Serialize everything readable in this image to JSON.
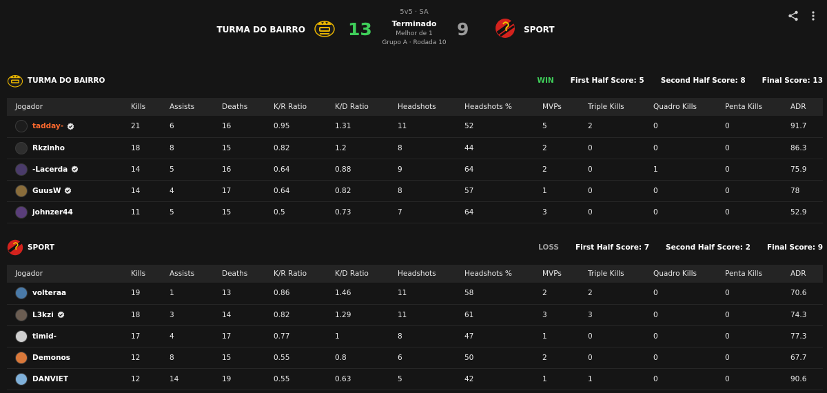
{
  "match": {
    "format": "5v5 · SA",
    "status": "Terminado",
    "best_of": "Melhor de 1",
    "group_round": "Grupo A · Rodada 10",
    "team_a": {
      "name": "TURMA DO BAIRRO",
      "score": "13"
    },
    "team_b": {
      "name": "SPORT",
      "score": "9"
    }
  },
  "colors": {
    "win": "#3fcf5a",
    "loss": "#9b9b9b",
    "highlight": "#ff6a2e",
    "background": "#151515",
    "header_row": "#242424"
  },
  "columns": [
    "Jogador",
    "Kills",
    "Assists",
    "Deaths",
    "K/R Ratio",
    "K/D Ratio",
    "Headshots",
    "Headshots %",
    "MVPs",
    "Triple Kills",
    "Quadro Kills",
    "Penta Kills",
    "ADR"
  ],
  "teams": [
    {
      "name": "TURMA DO BAIRRO",
      "result": "WIN",
      "first_half": "First Half Score: 5",
      "second_half": "Second Half Score: 8",
      "final": "Final Score: 13",
      "players": [
        {
          "name": "tadday-",
          "verified": true,
          "highlight": true,
          "stats": [
            "21",
            "6",
            "16",
            "0.95",
            "1.31",
            "11",
            "52",
            "5",
            "2",
            "0",
            "0",
            "91.7"
          ]
        },
        {
          "name": "Rkzinho",
          "verified": false,
          "highlight": false,
          "stats": [
            "18",
            "8",
            "15",
            "0.82",
            "1.2",
            "8",
            "44",
            "2",
            "0",
            "0",
            "0",
            "86.3"
          ]
        },
        {
          "name": "-Lacerda",
          "verified": true,
          "highlight": false,
          "stats": [
            "14",
            "5",
            "16",
            "0.64",
            "0.88",
            "9",
            "64",
            "2",
            "0",
            "1",
            "0",
            "75.9"
          ]
        },
        {
          "name": "GuusW",
          "verified": true,
          "highlight": false,
          "stats": [
            "14",
            "4",
            "17",
            "0.64",
            "0.82",
            "8",
            "57",
            "1",
            "0",
            "0",
            "0",
            "78"
          ]
        },
        {
          "name": "johnzer44",
          "verified": false,
          "highlight": false,
          "stats": [
            "11",
            "5",
            "15",
            "0.5",
            "0.73",
            "7",
            "64",
            "3",
            "0",
            "0",
            "0",
            "52.9"
          ]
        }
      ]
    },
    {
      "name": "SPORT",
      "result": "LOSS",
      "first_half": "First Half Score: 7",
      "second_half": "Second Half Score: 2",
      "final": "Final Score: 9",
      "players": [
        {
          "name": "volteraa",
          "verified": false,
          "highlight": false,
          "stats": [
            "19",
            "1",
            "13",
            "0.86",
            "1.46",
            "11",
            "58",
            "2",
            "2",
            "0",
            "0",
            "70.6"
          ]
        },
        {
          "name": "L3kzi",
          "verified": true,
          "highlight": false,
          "stats": [
            "18",
            "3",
            "14",
            "0.82",
            "1.29",
            "11",
            "61",
            "3",
            "3",
            "0",
            "0",
            "74.3"
          ]
        },
        {
          "name": "timid-",
          "verified": false,
          "highlight": false,
          "stats": [
            "17",
            "4",
            "17",
            "0.77",
            "1",
            "8",
            "47",
            "1",
            "0",
            "0",
            "0",
            "77.3"
          ]
        },
        {
          "name": "Demonos",
          "verified": false,
          "highlight": false,
          "stats": [
            "12",
            "8",
            "15",
            "0.55",
            "0.8",
            "6",
            "50",
            "2",
            "0",
            "0",
            "0",
            "67.7"
          ]
        },
        {
          "name": "DANVIET",
          "verified": false,
          "highlight": false,
          "stats": [
            "12",
            "14",
            "19",
            "0.55",
            "0.63",
            "5",
            "42",
            "1",
            "1",
            "0",
            "0",
            "90.6"
          ]
        }
      ]
    }
  ],
  "icons": {
    "share": "share-icon",
    "more": "more-vertical-icon",
    "verified": "verified-badge-icon"
  }
}
